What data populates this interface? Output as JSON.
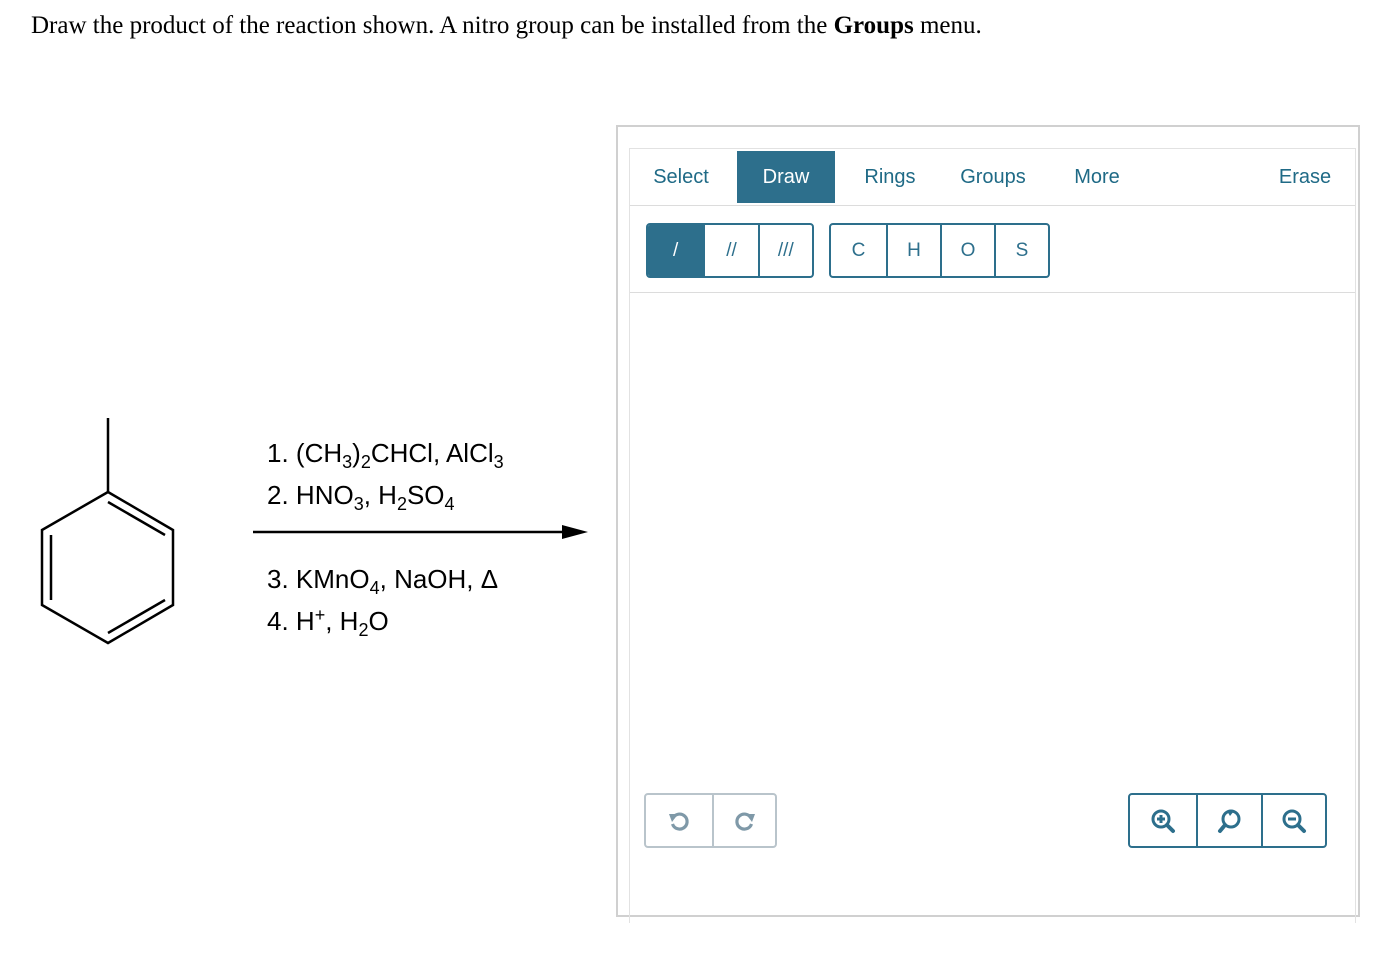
{
  "prompt": {
    "text_before": "Draw the product of the reaction shown. A nitro group can be installed from the ",
    "bold": "Groups",
    "text_after": " menu."
  },
  "reagents": {
    "step1": {
      "num": "1. ",
      "p1": "(CH",
      "s1": "3",
      "p2": ")",
      "s2": "2",
      "p3": "CHCl, AlCl",
      "s3": "3"
    },
    "step2": {
      "num": "2. ",
      "p1": "HNO",
      "s1": "3",
      "p2": ", H",
      "s2": "2",
      "p3": "SO",
      "s3": "4"
    },
    "step3": {
      "num": "3. ",
      "p1": "KMnO",
      "s1": "4",
      "p2": ", NaOH, Δ"
    },
    "step4": {
      "num": "4. ",
      "p1": "H",
      "sup": "+",
      "p2": ", H",
      "s2": "2",
      "p3": "O"
    }
  },
  "toolbar": {
    "tabs": [
      "Select",
      "Draw",
      "Rings",
      "Groups",
      "More",
      "Erase"
    ],
    "active_tab": "Draw",
    "bonds": [
      "/",
      "//",
      "///"
    ],
    "atoms": [
      "C",
      "H",
      "O",
      "S"
    ]
  },
  "colors": {
    "accent": "#2d6f8c",
    "disabled": "#b9c4cb",
    "border": "#d0d0d0"
  },
  "icons": {
    "undo": "undo-icon",
    "redo": "redo-icon",
    "zoom_in": "zoom-in-icon",
    "zoom_reset": "zoom-reset-icon",
    "zoom_out": "zoom-out-icon"
  }
}
